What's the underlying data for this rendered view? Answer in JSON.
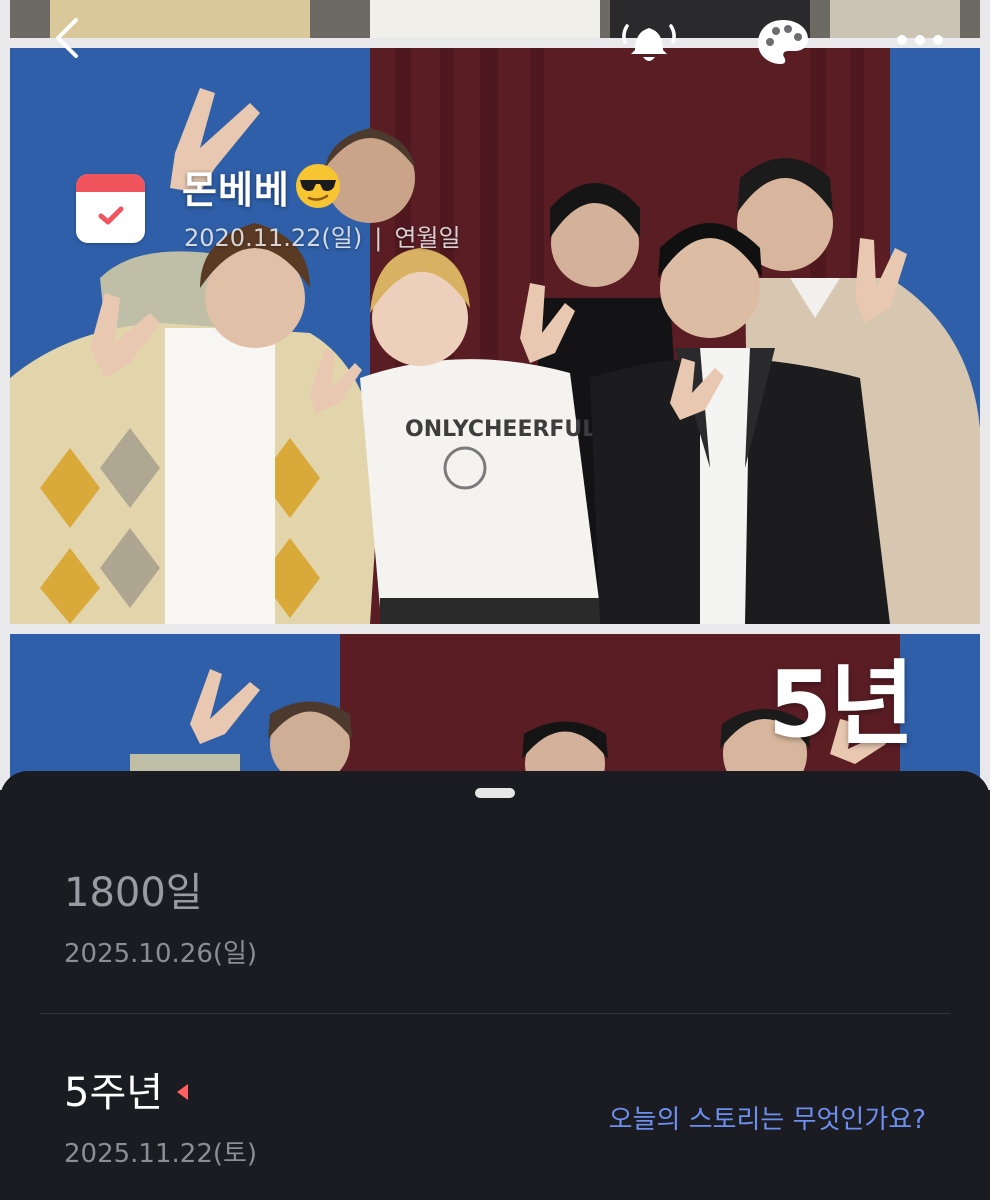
{
  "nav": {
    "back_icon": "chevron-left-icon",
    "bell_icon": "bell-icon",
    "palette_icon": "palette-icon",
    "more_icon": "more-horizontal-icon"
  },
  "header": {
    "title": "몬베베",
    "emoji_icon": "sunglasses-emoji-icon",
    "date": "2020.11.22(일)",
    "separator": "|",
    "mode": "연월일",
    "calendar_icon": "calendar-check-icon"
  },
  "photo": {
    "overlay_text": "5년"
  },
  "sheet": {
    "items": [
      {
        "title": "1800일",
        "date": "2025.10.26(일)"
      },
      {
        "title": "5주년",
        "date": "2025.11.22(토)"
      }
    ],
    "story_link": "오늘의 스토리는 무엇인가요?"
  },
  "colors": {
    "sheet_bg": "#1b1c21",
    "accent_red": "#f0555e",
    "link_blue": "#6c8ff0"
  }
}
